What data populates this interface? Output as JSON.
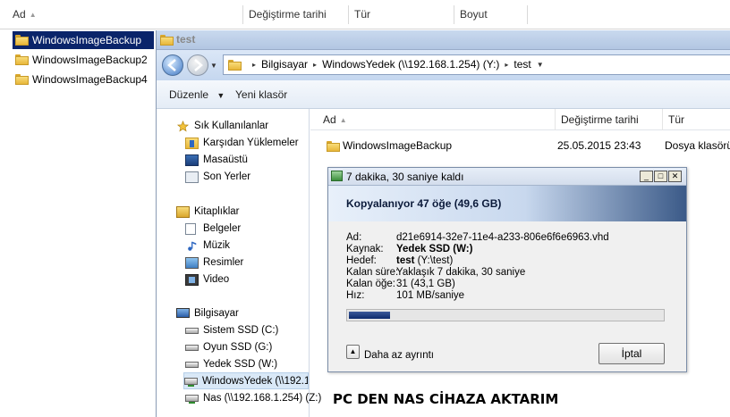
{
  "outer": {
    "columns": [
      "Ad",
      "Değiştirme tarihi",
      "Tür",
      "Boyut"
    ],
    "items": [
      "WindowsImageBackup",
      "WindowsImageBackup2",
      "WindowsImageBackup4"
    ]
  },
  "window": {
    "title": "test",
    "breadcrumb": [
      "Bilgisayar",
      "WindowsYedek (\\\\192.168.1.254) (Y:)",
      "test"
    ],
    "toolbar": {
      "organize": "Düzenle",
      "new_folder": "Yeni klasör"
    }
  },
  "nav": {
    "favorites": {
      "label": "Sık Kullanılanlar",
      "items": [
        "Karşıdan Yüklemeler",
        "Masaüstü",
        "Son Yerler"
      ]
    },
    "libraries": {
      "label": "Kitaplıklar",
      "items": [
        "Belgeler",
        "Müzik",
        "Resimler",
        "Video"
      ]
    },
    "computer": {
      "label": "Bilgisayar",
      "items": [
        "Sistem SSD (C:)",
        "Oyun SSD (G:)",
        "Yedek SSD (W:)",
        "WindowsYedek (\\\\192.1",
        "Nas (\\\\192.168.1.254) (Z:)"
      ]
    }
  },
  "content": {
    "columns": [
      "Ad",
      "Değiştirme tarihi",
      "Tür"
    ],
    "row": {
      "name": "WindowsImageBackup",
      "date": "25.05.2015 23:43",
      "type": "Dosya klasörü"
    }
  },
  "dialog": {
    "title": "7 dakika, 30 saniye kaldı",
    "heading": "Kopyalanıyor 47 öğe (49,6 GB)",
    "labels": {
      "name": "Ad:",
      "source": "Kaynak:",
      "dest": "Hedef:",
      "remaining_time": "Kalan süre:",
      "remaining_items": "Kalan öğe:",
      "speed": "Hız:"
    },
    "values": {
      "name": "d21e6914-32e7-11e4-a233-806e6f6e6963.vhd",
      "source": "Yedek SSD (W:)",
      "dest_bold": "test",
      "dest_rest": " (Y:\\test)",
      "remaining_time": "Yaklaşık 7 dakika, 30 saniye",
      "remaining_items": "31 (43,1 GB)",
      "speed": "101 MB/saniye"
    },
    "progress": 0.13,
    "less_details": "Daha az ayrıntı",
    "cancel": "İptal"
  },
  "caption": "PC DEN NAS CİHAZA AKTARIM",
  "colors": {
    "selection": "#0a246a",
    "progress": "#0e2a6b",
    "folder": "#e8b73a"
  }
}
